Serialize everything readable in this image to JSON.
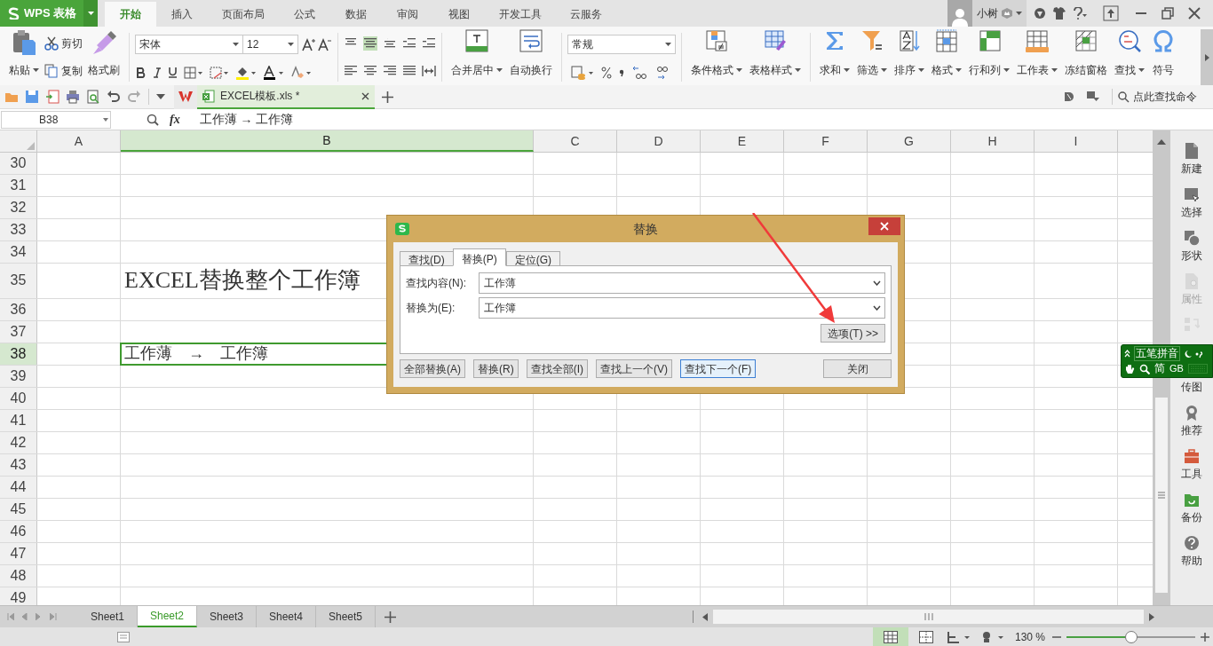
{
  "app": {
    "name": "WPS 表格"
  },
  "menu_tabs": [
    {
      "label": "开始",
      "selected": true
    },
    {
      "label": "插入",
      "selected": false
    },
    {
      "label": "页面布局",
      "selected": false
    },
    {
      "label": "公式",
      "selected": false
    },
    {
      "label": "数据",
      "selected": false
    },
    {
      "label": "审阅",
      "selected": false
    },
    {
      "label": "视图",
      "selected": false
    },
    {
      "label": "开发工具",
      "selected": false
    },
    {
      "label": "云服务",
      "selected": false
    }
  ],
  "user": {
    "name": "小树"
  },
  "ribbon": {
    "paste": "粘贴",
    "cut": "剪切",
    "copy": "复制",
    "format_painter": "格式刷",
    "font_name": "宋体",
    "font_size": "12",
    "merge": "合并居中",
    "wrap": "自动换行",
    "number_format": "常规",
    "tools": [
      {
        "label": "条件格式",
        "dropdown": true
      },
      {
        "label": "表格样式",
        "dropdown": true
      },
      {
        "label": "求和",
        "dropdown": true
      },
      {
        "label": "筛选",
        "dropdown": true
      },
      {
        "label": "排序",
        "dropdown": true
      },
      {
        "label": "格式",
        "dropdown": true
      },
      {
        "label": "行和列",
        "dropdown": true
      },
      {
        "label": "工作表",
        "dropdown": true
      },
      {
        "label": "冻结窗格",
        "dropdown": false
      },
      {
        "label": "查找",
        "dropdown": true
      },
      {
        "label": "符号",
        "dropdown": false
      }
    ]
  },
  "document_tab": {
    "title": "EXCEL模板.xls *"
  },
  "command_search": {
    "placeholder": "点此查找命令"
  },
  "formula_bar": {
    "cell": "B38",
    "fx": "fx",
    "value": "工作薄 → 工作簿"
  },
  "sheet": {
    "columns": [
      {
        "label": "A",
        "selected": false
      },
      {
        "label": "B",
        "selected": true
      },
      {
        "label": "C",
        "selected": false
      },
      {
        "label": "D",
        "selected": false
      },
      {
        "label": "E",
        "selected": false
      },
      {
        "label": "F",
        "selected": false
      },
      {
        "label": "G",
        "selected": false
      },
      {
        "label": "H",
        "selected": false
      },
      {
        "label": "I",
        "selected": false
      }
    ],
    "rows": [
      {
        "label": "30",
        "selected": false
      },
      {
        "label": "31",
        "selected": false
      },
      {
        "label": "32",
        "selected": false
      },
      {
        "label": "33",
        "selected": false
      },
      {
        "label": "34",
        "selected": false
      },
      {
        "label": "35",
        "selected": false,
        "column_b": "EXCEL替换整个工作簿",
        "kind": "title"
      },
      {
        "label": "36",
        "selected": false
      },
      {
        "label": "37",
        "selected": false
      },
      {
        "label": "38",
        "selected": true,
        "column_b": "工作薄　→　工作簿",
        "kind": "normal"
      },
      {
        "label": "39",
        "selected": false
      },
      {
        "label": "40",
        "selected": false
      },
      {
        "label": "41",
        "selected": false
      },
      {
        "label": "42",
        "selected": false
      },
      {
        "label": "43",
        "selected": false
      },
      {
        "label": "44",
        "selected": false
      },
      {
        "label": "45",
        "selected": false
      },
      {
        "label": "46",
        "selected": false
      },
      {
        "label": "47",
        "selected": false
      },
      {
        "label": "48",
        "selected": false
      },
      {
        "label": "49",
        "selected": false
      }
    ]
  },
  "dialog": {
    "title": "替换",
    "tabs": [
      {
        "label": "查找(D)",
        "selected": false
      },
      {
        "label": "替换(P)",
        "selected": true
      },
      {
        "label": "定位(G)",
        "selected": false
      }
    ],
    "fields": [
      {
        "label": "查找内容(N):",
        "value": "工作薄"
      },
      {
        "label": "替换为(E):",
        "value": "工作簿"
      }
    ],
    "options_button": "选项(T) >>",
    "buttons": [
      {
        "label": "全部替换(A)",
        "focused": false
      },
      {
        "label": "替换(R)",
        "focused": false
      },
      {
        "label": "查找全部(I)",
        "focused": false
      },
      {
        "label": "查找上一个(V)",
        "focused": false
      },
      {
        "label": "查找下一个(F)",
        "focused": true
      }
    ],
    "close_button": "关闭"
  },
  "side_panel": [
    {
      "label": "新建",
      "disabled": false
    },
    {
      "label": "选择",
      "disabled": false
    },
    {
      "label": "形状",
      "disabled": false
    },
    {
      "label": "属性",
      "disabled": true
    },
    {
      "disabled": true
    },
    {
      "label": "传图",
      "disabled": false
    },
    {
      "label": "推荐",
      "disabled": false
    },
    {
      "label": "工具",
      "disabled": false
    },
    {
      "label": "备份",
      "disabled": false
    },
    {
      "label": "帮助",
      "disabled": false
    }
  ],
  "ime_bar": {
    "mode": "五笔拼音",
    "script": "简",
    "charset": "GB"
  },
  "sheet_tabs": [
    {
      "label": "Sheet1",
      "selected": false
    },
    {
      "label": "Sheet2",
      "selected": true
    },
    {
      "label": "Sheet3",
      "selected": false
    },
    {
      "label": "Sheet4",
      "selected": false
    },
    {
      "label": "Sheet5",
      "selected": false
    }
  ],
  "status_bar": {
    "zoom": "130 %",
    "zoom_slider": {
      "level": 0.5
    }
  }
}
